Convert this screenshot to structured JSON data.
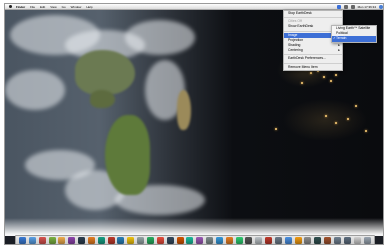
{
  "menubar": {
    "app": "Finder",
    "items": [
      "File",
      "Edit",
      "View",
      "Go",
      "Window",
      "Help"
    ],
    "clock": "Mon 17:36:34"
  },
  "earthdesk_menu": {
    "items": [
      {
        "label": "Stop EarthDesk",
        "state": "normal"
      },
      {
        "separator": true
      },
      {
        "label": "Cities Off",
        "state": "disabled"
      },
      {
        "label": "Show EarthDesk",
        "state": "normal"
      },
      {
        "separator": true
      },
      {
        "label": "Image",
        "state": "highlighted",
        "submenu": true
      },
      {
        "label": "Projection",
        "state": "normal",
        "submenu": true
      },
      {
        "label": "Shading",
        "state": "normal",
        "submenu": true
      },
      {
        "label": "Centering",
        "state": "normal",
        "submenu": true
      },
      {
        "separator": true
      },
      {
        "label": "EarthDesk Preferences...",
        "state": "normal"
      },
      {
        "separator": true
      },
      {
        "label": "Remove Menu Item",
        "state": "normal"
      }
    ]
  },
  "image_submenu": {
    "items": [
      {
        "label": "Living Earth™ Satellite",
        "state": "normal"
      },
      {
        "label": "Political",
        "state": "normal"
      },
      {
        "label": "Terrain",
        "state": "highlighted",
        "checked": true
      }
    ]
  },
  "dock": {
    "icon_colors": [
      "#3a7bd5",
      "#5aa0e6",
      "#d9534f",
      "#7cb342",
      "#f0ad4e",
      "#8e44ad",
      "#2c3e50",
      "#e67e22",
      "#16a085",
      "#c0392b",
      "#2980b9",
      "#f1c40f",
      "#95a5a6",
      "#27ae60",
      "#e74c3c",
      "#34495e",
      "#d35400",
      "#1abc9c",
      "#9b59b6",
      "#7f8c8d",
      "#3498db",
      "#e67e22",
      "#2ecc71",
      "#555555",
      "#bdc3c7",
      "#c0392b",
      "#6c7a89",
      "#4a90e2",
      "#f39c12",
      "#8e8e8e",
      "#2f4f4f",
      "#a0522d",
      "#708090",
      "#5d6d7e",
      "#d0d0d0",
      "#9aa5b1"
    ]
  }
}
